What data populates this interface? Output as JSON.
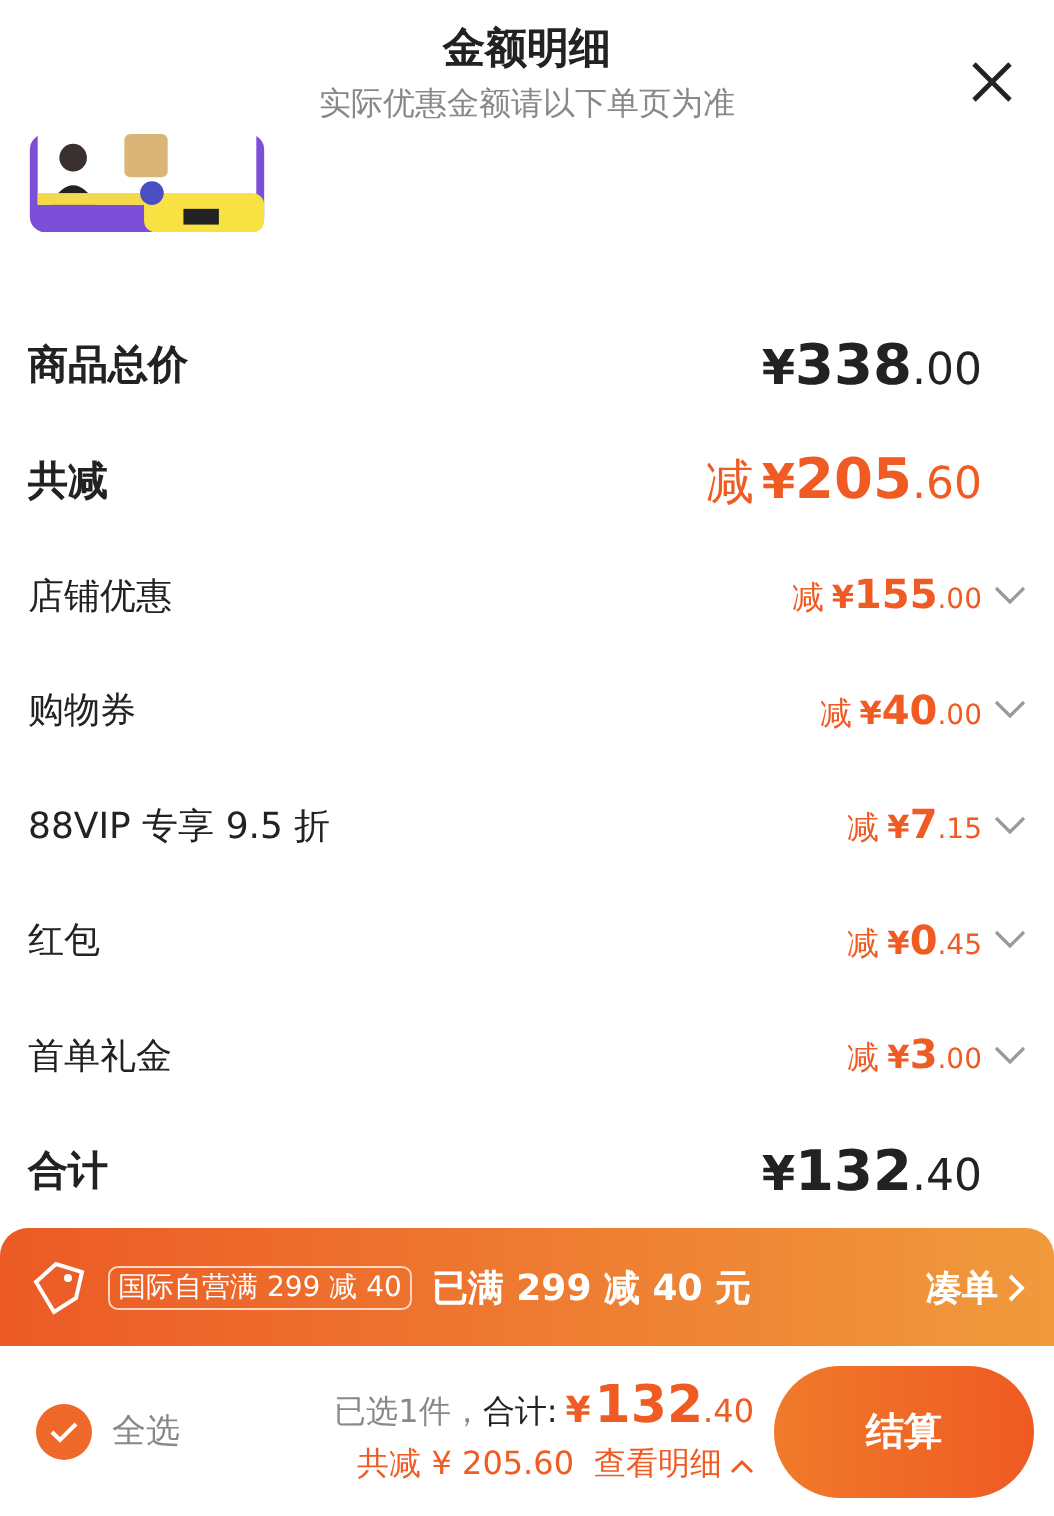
{
  "header": {
    "title": "金额明细",
    "subtitle": "实际优惠金额请以下单页为准"
  },
  "rows": [
    {
      "kind": "total",
      "label": "商品总价",
      "currency": "¥",
      "whole": "338",
      "fraction": ".00"
    },
    {
      "kind": "discount_total",
      "label": "共减",
      "prefix": "减",
      "currency": "¥",
      "whole": "205",
      "fraction": ".60"
    },
    {
      "kind": "discount",
      "label": "店铺优惠",
      "prefix": "减",
      "currency": "¥",
      "whole": "155",
      "fraction": ".00"
    },
    {
      "kind": "discount",
      "label": "购物券",
      "prefix": "减",
      "currency": "¥",
      "whole": "40",
      "fraction": ".00"
    },
    {
      "kind": "discount",
      "label": "88VIP 专享 9.5 折",
      "prefix": "减",
      "currency": "¥",
      "whole": "7",
      "fraction": ".15"
    },
    {
      "kind": "discount",
      "label": "红包",
      "prefix": "减",
      "currency": "¥",
      "whole": "0",
      "fraction": ".45"
    },
    {
      "kind": "discount",
      "label": "首单礼金",
      "prefix": "减",
      "currency": "¥",
      "whole": "3",
      "fraction": ".00"
    },
    {
      "kind": "total",
      "label": "合计",
      "currency": "¥",
      "whole": "132",
      "fraction": ".40"
    }
  ],
  "promo_banner": {
    "tag": "国际自营满 299 减 40",
    "message": "已满 299 减 40 元",
    "action": "凑单"
  },
  "footer": {
    "select_all": {
      "label": "全选",
      "checked": true
    },
    "selected_count": "已选1件，",
    "total_label": "合计:",
    "currency": "¥",
    "whole": "132",
    "fraction": ".40",
    "saved": "共减 ¥ 205.60",
    "details_link": "查看明细",
    "checkout": "结算"
  }
}
